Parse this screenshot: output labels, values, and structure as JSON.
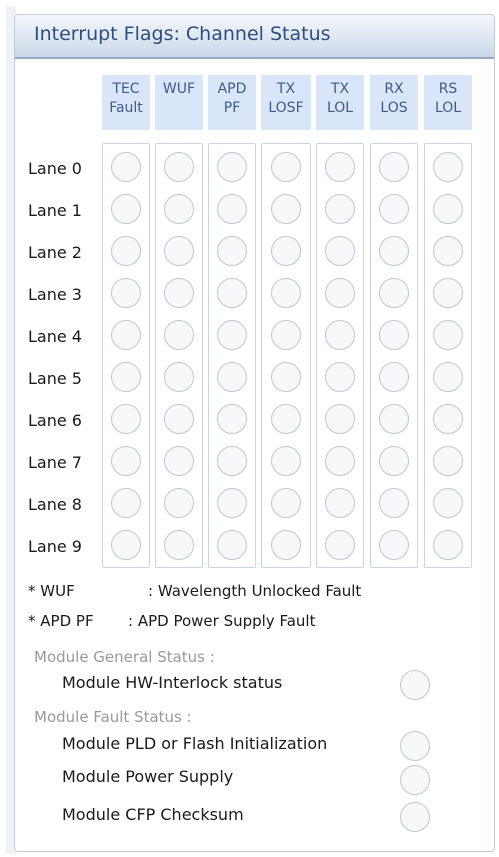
{
  "panel": {
    "title": "Interrupt Flags: Channel Status"
  },
  "columns": [
    {
      "line1": "TEC",
      "line2": "Fault"
    },
    {
      "line1": "WUF",
      "line2": ""
    },
    {
      "line1": "APD",
      "line2": "PF"
    },
    {
      "line1": "TX",
      "line2": "LOSF"
    },
    {
      "line1": "TX",
      "line2": "LOL"
    },
    {
      "line1": "RX",
      "line2": "LOS"
    },
    {
      "line1": "RS",
      "line2": "LOL"
    }
  ],
  "lanes": [
    "Lane 0",
    "Lane 1",
    "Lane 2",
    "Lane 3",
    "Lane 4",
    "Lane 5",
    "Lane 6",
    "Lane 7",
    "Lane 8",
    "Lane 9"
  ],
  "notes": {
    "wuf_key": "* WUF",
    "wuf_desc": ": Wavelength Unlocked Fault",
    "apd_key": "* APD PF",
    "apd_desc": ": APD Power Supply Fault"
  },
  "general_status": {
    "heading": "Module General Status :",
    "items": [
      "Module HW-Interlock status"
    ]
  },
  "fault_status": {
    "heading": "Module Fault Status :",
    "items": [
      "Module PLD or Flash Initialization",
      "Module Power Supply",
      "Module CFP Checksum"
    ]
  },
  "colors": {
    "title": "#2c4e7e",
    "column_header_bg": "#d9e6f9",
    "led_off": "#f7f8fa",
    "section_heading": "#9a9a9a"
  },
  "icons": {
    "status_indicator": "circle-led-off-icon"
  }
}
